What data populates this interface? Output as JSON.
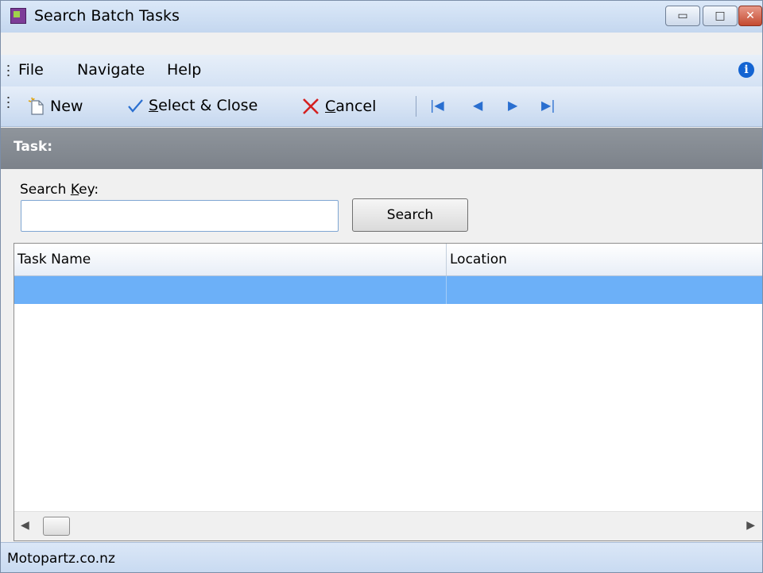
{
  "window": {
    "title": "Search Batch Tasks",
    "minimize_glyph": "▭",
    "maximize_glyph": "□",
    "close_glyph": "✕"
  },
  "menubar": {
    "items": [
      "File",
      "Navigate",
      "Help"
    ],
    "info_glyph": "i"
  },
  "toolbar": {
    "new_label": "New",
    "select_close_prefix": "S",
    "select_close_rest": "elect & Close",
    "cancel_prefix": "C",
    "cancel_rest": "ancel",
    "nav_first": "|◀",
    "nav_prev": "◀",
    "nav_next": "▶",
    "nav_last": "▶|"
  },
  "section": {
    "title": "Task:"
  },
  "search": {
    "label_prefix": "Search ",
    "label_key": "K",
    "label_rest": "ey:",
    "value": "",
    "button_label": "Search"
  },
  "grid": {
    "columns": [
      "Task Name",
      "Location"
    ],
    "rows": [
      [
        "",
        ""
      ]
    ],
    "scroll_left": "◀",
    "scroll_right": "▶"
  },
  "status": {
    "text": "Motopartz.co.nz"
  },
  "colors": {
    "selection": "#6cb0f8",
    "section_header": "#858b92",
    "chrome": "#c8daf1",
    "cancel_icon": "#d42020",
    "check_icon": "#2a6fd0"
  }
}
